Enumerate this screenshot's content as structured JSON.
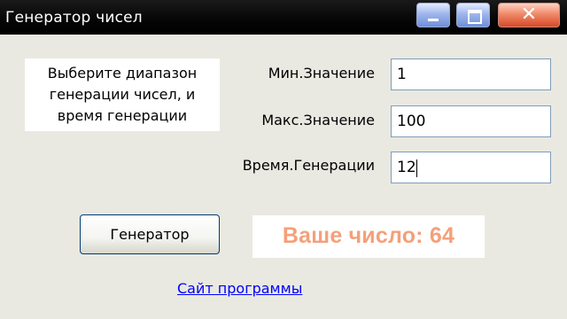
{
  "window": {
    "title": "Генератор чисел",
    "controls": {
      "minimize_icon": "minimize-icon",
      "maximize_icon": "maximize-icon",
      "close_icon": "close-icon",
      "close_glyph": "✕"
    }
  },
  "hint": {
    "text": "Выберите диапазон\nгенерации чисел, и\nвремя генерации"
  },
  "form": {
    "min_label": "Мин.Значение",
    "min_value": "1",
    "max_label": "Макс.Значение",
    "max_value": "100",
    "time_label": "Время.Генерации",
    "time_value": "12"
  },
  "generate_button": {
    "label": "Генератор"
  },
  "result": {
    "text": "Ваше число: 64",
    "color": "#f4a07a"
  },
  "site_link": {
    "label": "Сайт программы"
  }
}
